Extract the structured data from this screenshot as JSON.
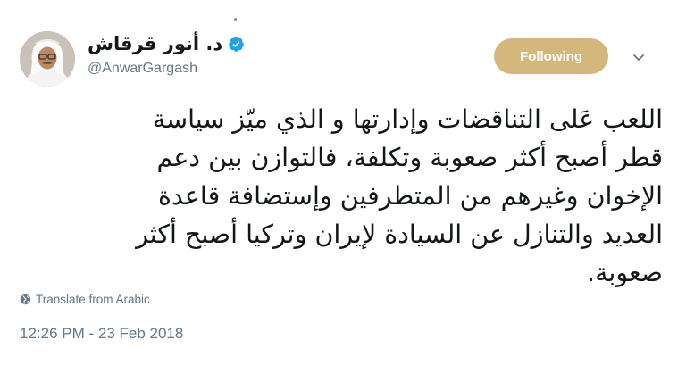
{
  "tweet": {
    "author": {
      "display_name": "د. أنور قرقاش",
      "handle": "@AnwarGargash",
      "verified": true,
      "avatar_icon": "user-avatar-photo"
    },
    "follow_button": {
      "label": "Following",
      "color": "#d4b77c"
    },
    "menu_icon": "chevron-down-icon",
    "text_lines": [
      "اللعب عَلى التناقضات وإدارتها و الذي ميّز سياسة",
      "قطر أصبح أكثر صعوبة وتكلفة، فالتوازن بين دعم",
      "الإخوان وغيرهم من المتطرفين وإستضافة قاعدة",
      "العديد والتنازل عن السيادة لإيران وتركيا أصبح أكثر",
      "صعوبة."
    ],
    "translate": {
      "icon": "globe-icon",
      "label": "Translate from Arabic"
    },
    "timestamp": "12:26 PM - 23 Feb 2018"
  },
  "colors": {
    "text_primary": "#14171a",
    "text_secondary": "#657786",
    "verified_blue": "#1da1f2",
    "divider": "#e6ecf0"
  }
}
